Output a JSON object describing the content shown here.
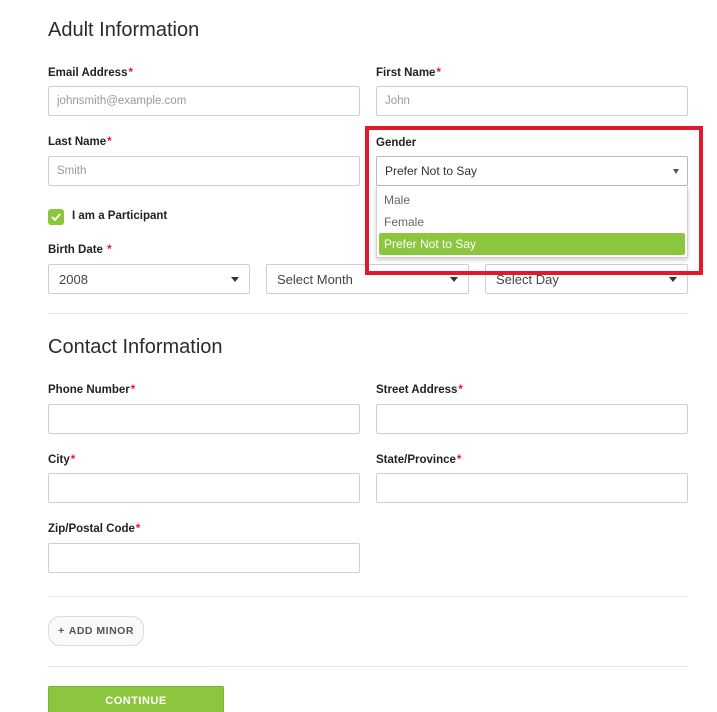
{
  "adult_section": {
    "title": "Adult Information",
    "email": {
      "label": "Email Address",
      "placeholder": "johnsmith@example.com"
    },
    "first_name": {
      "label": "First Name",
      "placeholder": "John"
    },
    "last_name": {
      "label": "Last Name",
      "placeholder": "Smith"
    },
    "gender": {
      "label": "Gender",
      "selected": "Prefer Not to Say",
      "options": [
        "Male",
        "Female",
        "Prefer Not to Say"
      ]
    },
    "participant_checkbox": {
      "label": "I am a Participant",
      "checked": true
    },
    "birth_date": {
      "label": "Birth Date",
      "year": "2008",
      "month": "Select Month",
      "day": "Select Day"
    }
  },
  "contact_section": {
    "title": "Contact Information",
    "phone": {
      "label": "Phone Number"
    },
    "street": {
      "label": "Street Address"
    },
    "city": {
      "label": "City"
    },
    "state": {
      "label": "State/Province"
    },
    "zip": {
      "label": "Zip/Postal Code"
    }
  },
  "actions": {
    "add_minor_icon": "+",
    "add_minor": "ADD MINOR",
    "continue": "CONTINUE"
  },
  "required_marker": "*",
  "colors": {
    "accent": "#8cc63f",
    "required": "#e3192b",
    "highlight": "#e3192b"
  }
}
